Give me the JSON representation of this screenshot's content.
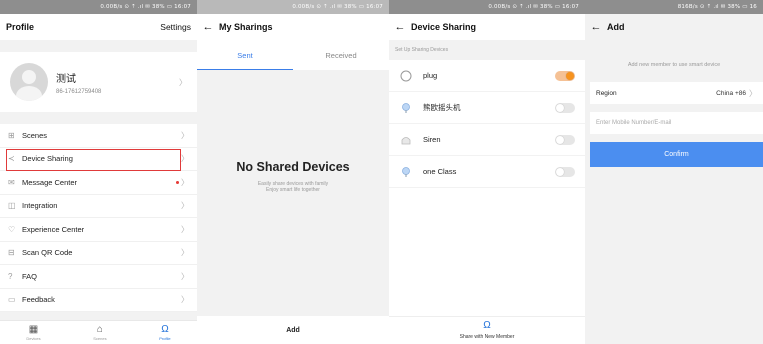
{
  "status_bars": [
    "0.00B/s ⊙ ⇡ .ıl ✉ 38% ▭ 16:07",
    "0.00B/s ⊙ ⇡ .ıl ✉ 38% ▭ 16:07",
    "0.00B/s ⊙ ⇡ .ıl ✉ 38% ▭ 16:07",
    "816B/s ⊙ ⇡ .ıl ✉ 38% ▭ 16"
  ],
  "profile": {
    "title": "Profile",
    "settings": "Settings",
    "name": "测试",
    "phone": "86-17612759408",
    "menu": [
      {
        "label": "Scenes",
        "icon": "⊞"
      },
      {
        "label": "Device Sharing",
        "icon": "≺"
      },
      {
        "label": "Message Center",
        "icon": "✉"
      },
      {
        "label": "Integration",
        "icon": "◫"
      },
      {
        "label": "Experience Center",
        "icon": "♡"
      },
      {
        "label": "Scan QR Code",
        "icon": "⊟"
      },
      {
        "label": "FAQ",
        "icon": "?"
      },
      {
        "label": "Feedback",
        "icon": "▭"
      }
    ],
    "tabs": [
      "Devices",
      "Scenes",
      "Profile"
    ]
  },
  "my_sharings": {
    "title": "My Sharings",
    "tabs": [
      "Sent",
      "Received"
    ],
    "empty_title": "No Shared Devices",
    "empty_sub1": "Easily share devices with family",
    "empty_sub2": "Enjoy smart life together",
    "add": "Add"
  },
  "device_sharing": {
    "title": "Device Sharing",
    "section": "Set Up Sharing Devices",
    "devices": [
      {
        "name": "plug",
        "on": true
      },
      {
        "name": "熊欧摇头机",
        "on": false
      },
      {
        "name": "Siren",
        "on": false
      },
      {
        "name": "one Class",
        "on": false
      }
    ],
    "share_label": "Share with New Member"
  },
  "add": {
    "title": "Add",
    "hint": "Add new member to use smart device",
    "region_label": "Region",
    "region_value": "China +86",
    "phone_placeholder": "Enter Mobile Number/E-mail",
    "confirm": "Confirm"
  },
  "colors": {
    "accent": "#3a7de8",
    "highlight": "#e03a3a",
    "toggle_on": "#f7931e",
    "confirm": "#4b8ef0"
  }
}
